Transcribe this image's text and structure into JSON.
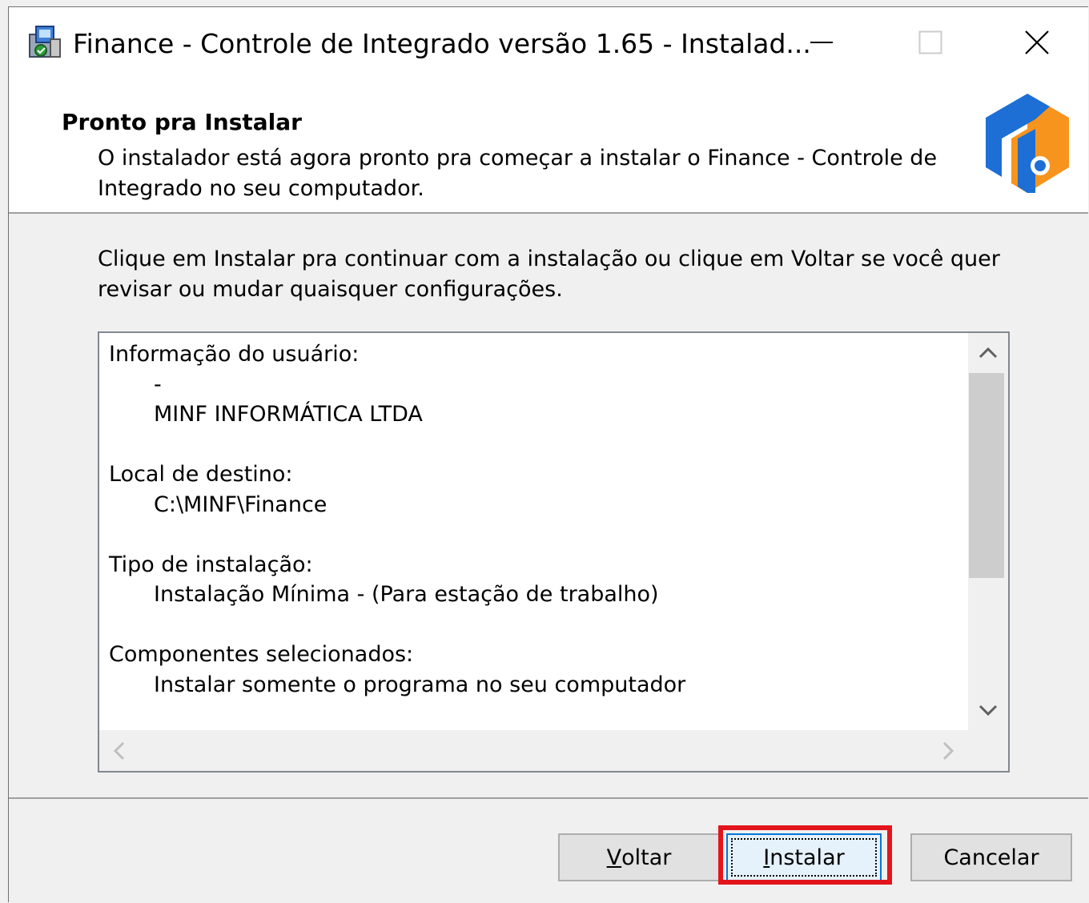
{
  "window": {
    "title": "Finance - Controle de Integrado versão 1.65 - Instalad..."
  },
  "header": {
    "title": "Pronto pra Instalar",
    "description": "O instalador está agora pronto pra começar a instalar o Finance - Controle de Integrado no seu computador."
  },
  "body": {
    "intro": "Clique em Instalar pra continuar com a instalação ou clique em Voltar se você quer revisar ou mudar quaisquer configurações.",
    "memo": {
      "sections": [
        {
          "title": "Informação do usuário:",
          "lines": [
            "-",
            "MINF INFORMÁTICA LTDA"
          ]
        },
        {
          "title": "Local de destino:",
          "lines": [
            "C:\\MINF\\Finance"
          ]
        },
        {
          "title": "Tipo de instalação:",
          "lines": [
            "Instalação Mínima - (Para estação de trabalho)"
          ]
        },
        {
          "title": "Componentes selecionados:",
          "lines": [
            "Instalar somente o programa no seu computador"
          ]
        }
      ]
    }
  },
  "buttons": {
    "back": {
      "accel": "V",
      "rest": "oltar"
    },
    "install": {
      "accel": "I",
      "rest": "nstalar"
    },
    "cancel": "Cancelar"
  },
  "colors": {
    "highlight": "#e3151c",
    "logo_blue": "#1d6fd6",
    "logo_orange": "#f7941d"
  }
}
